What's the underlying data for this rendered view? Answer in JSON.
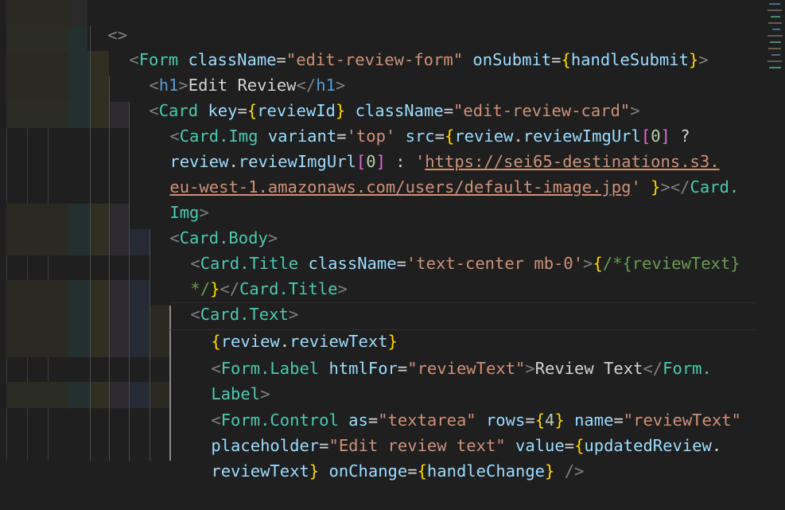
{
  "editor": {
    "lines": [
      [
        "<>"
      ],
      [
        "<",
        "Form",
        " ",
        "className",
        "=",
        "\"edit-review-form\"",
        " ",
        "onSubmit",
        "=",
        "{",
        "handleSubmit",
        "}",
        ">"
      ],
      [
        "<",
        "h1",
        ">",
        "Edit Review",
        "</",
        "h1",
        ">"
      ],
      [
        "<",
        "Card",
        " ",
        "key",
        "=",
        "{",
        "reviewId",
        "}",
        " ",
        "className",
        "=",
        "\"edit-review-card\"",
        ">"
      ],
      [
        "<",
        "Card.Img",
        " ",
        "variant",
        "=",
        "'top'",
        " ",
        "src",
        "=",
        "{",
        "review",
        ".",
        "reviewImgUrl",
        "[",
        "0",
        "]",
        " ",
        "?"
      ],
      [
        "review",
        ".",
        "reviewImgUrl",
        "[",
        "0",
        "]",
        " : ",
        "'",
        "https://sei65-destinations.s3."
      ],
      [
        "eu-west-1.amazonaws.com/users/default-image.jpg",
        "'",
        " ",
        "}",
        "></",
        "Card."
      ],
      [
        "Img",
        ">"
      ],
      [
        "<",
        "Card.Body",
        ">"
      ],
      [
        "<",
        "Card.Title",
        " ",
        "className",
        "=",
        "'text-center mb-0'",
        ">",
        "{",
        "/*{reviewText}"
      ],
      [
        "*/",
        "}",
        "</",
        "Card.Title",
        ">"
      ],
      [
        "<",
        "Card.Text",
        ">"
      ],
      [
        "{",
        "review",
        ".",
        "reviewText",
        "}"
      ],
      [
        "<",
        "Form.Label",
        " ",
        "htmlFor",
        "=",
        "\"reviewText\"",
        ">",
        "Review Text",
        "</",
        "Form."
      ],
      [
        "Label",
        ">"
      ],
      [
        "<",
        "Form.Control",
        " ",
        "as",
        "=",
        "\"textarea\"",
        " ",
        "rows",
        "=",
        "{",
        "4",
        "}",
        " ",
        "name",
        "=",
        "\"reviewText\""
      ],
      [
        "placeholder",
        "=",
        "\"Edit review text\"",
        " ",
        "value",
        "=",
        "{",
        "updatedReview",
        "."
      ],
      [
        "reviewText",
        "}",
        " ",
        "onChange",
        "=",
        "{",
        "handleChange",
        "}",
        " />"
      ]
    ]
  },
  "colors": {
    "background": "#1f1f1f",
    "tag_bracket": "#808080",
    "component": "#4ec9b0",
    "html_tag": "#569cd6",
    "attribute": "#9cdcfe",
    "string": "#ce9178",
    "brace": "#ffd700",
    "number": "#b5cea8",
    "comment": "#6a9955",
    "text": "#d4d4d4"
  }
}
